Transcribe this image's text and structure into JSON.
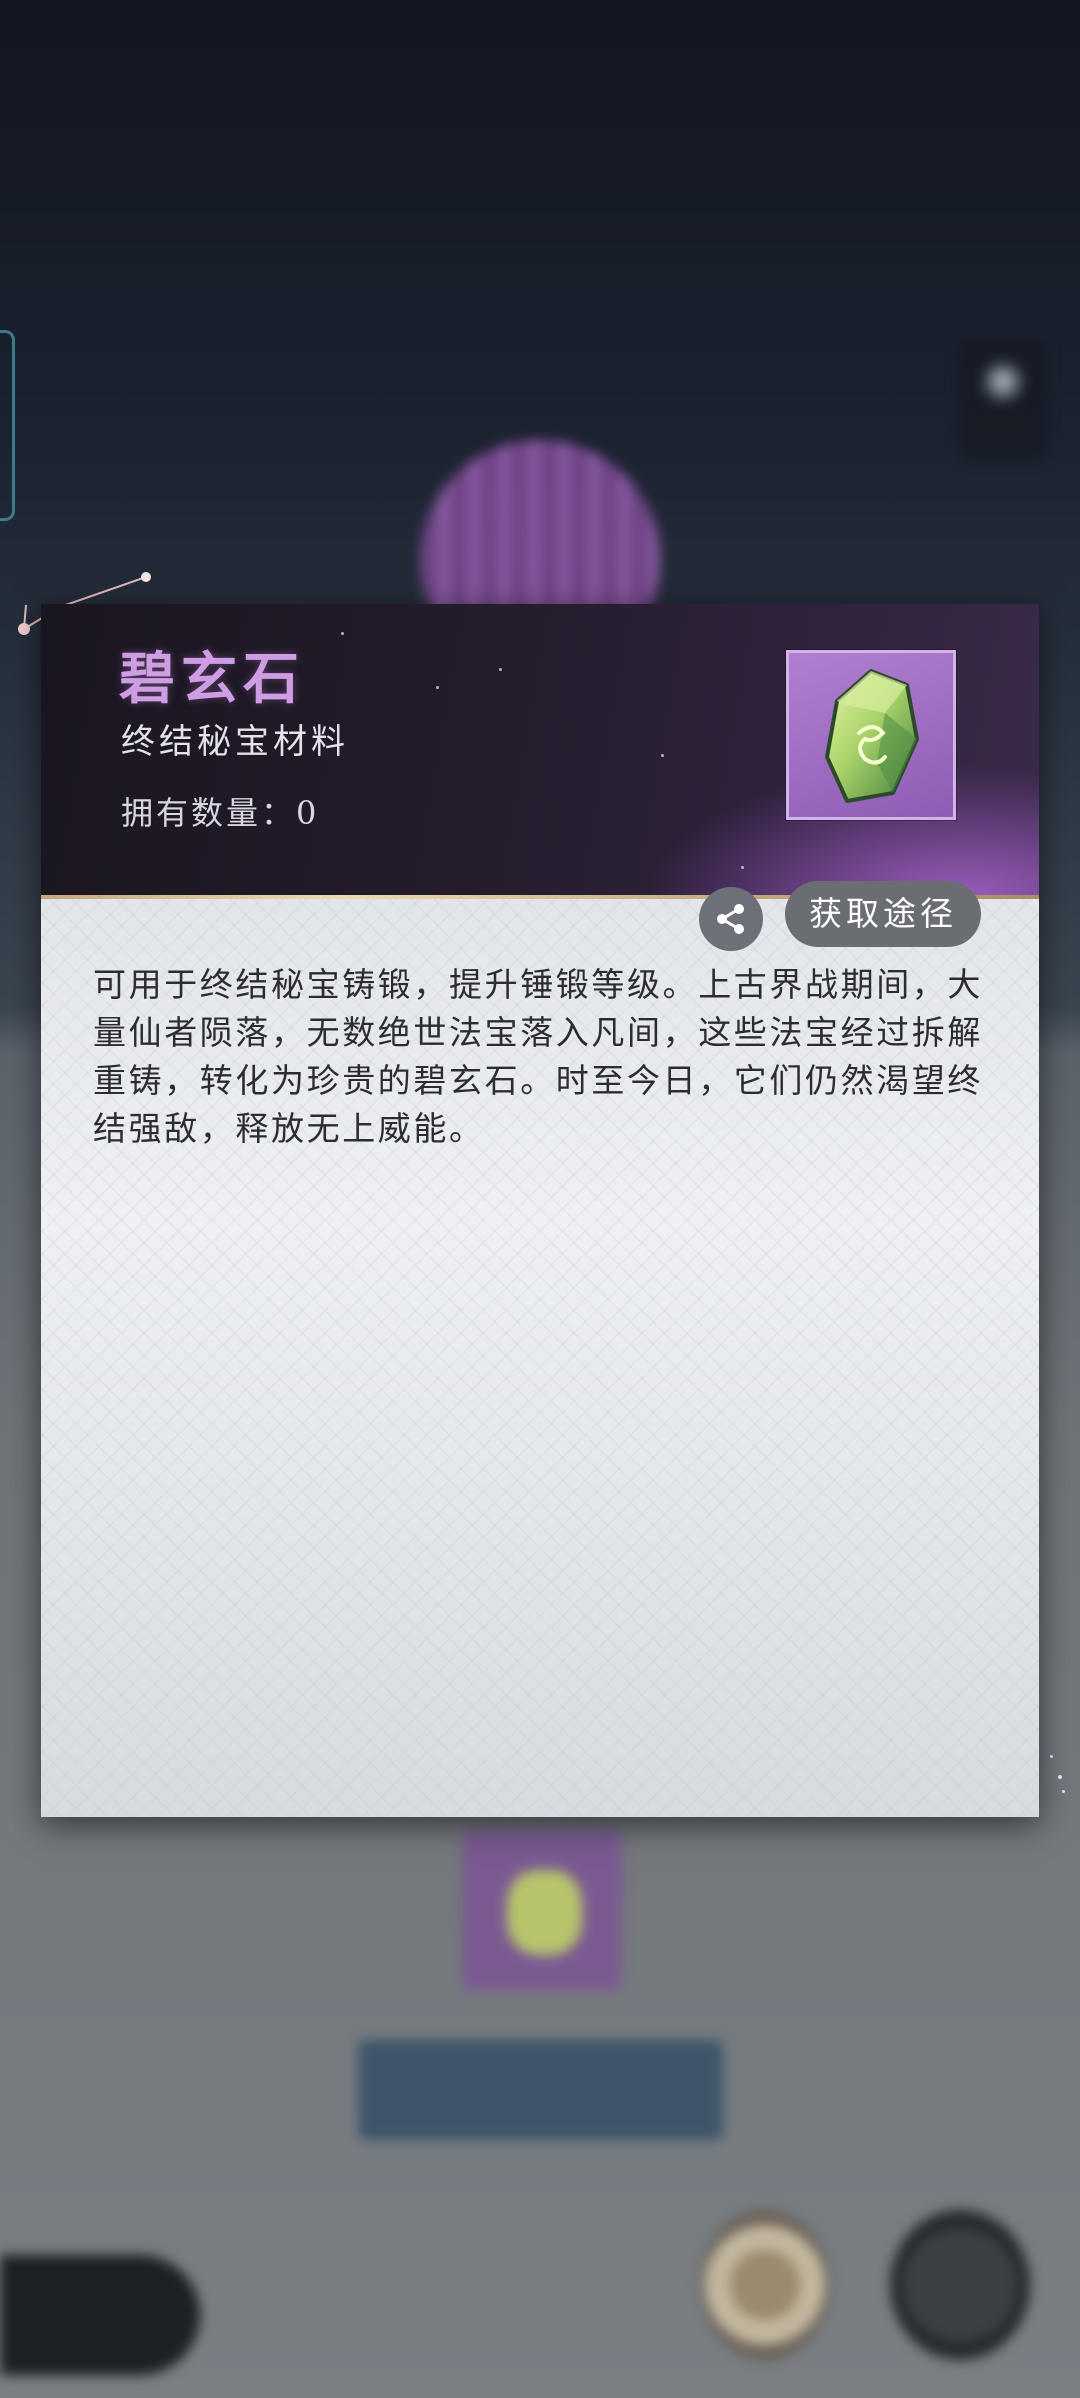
{
  "item": {
    "name": "碧玄石",
    "category": "终结秘宝材料",
    "owned_label": "拥有数量：",
    "owned_count": "0",
    "description": "可用于终结秘宝铸锻，提升锤锻等级。上古界战期间，大量仙者陨落，无数绝世法宝落入凡间，这些法宝经过拆解重铸，转化为珍贵的碧玄石。时至今日，它们仍然渴望终结强敌，释放无上威能。",
    "icon": "green-rune-crystal-icon",
    "rarity_color": "#a874cc"
  },
  "actions": {
    "acquire_label": "获取途径",
    "share_icon": "share-icon"
  },
  "colors": {
    "title": "#cf9de4",
    "header_bg": "#241c2c",
    "body_bg": "#e6e9ec"
  }
}
